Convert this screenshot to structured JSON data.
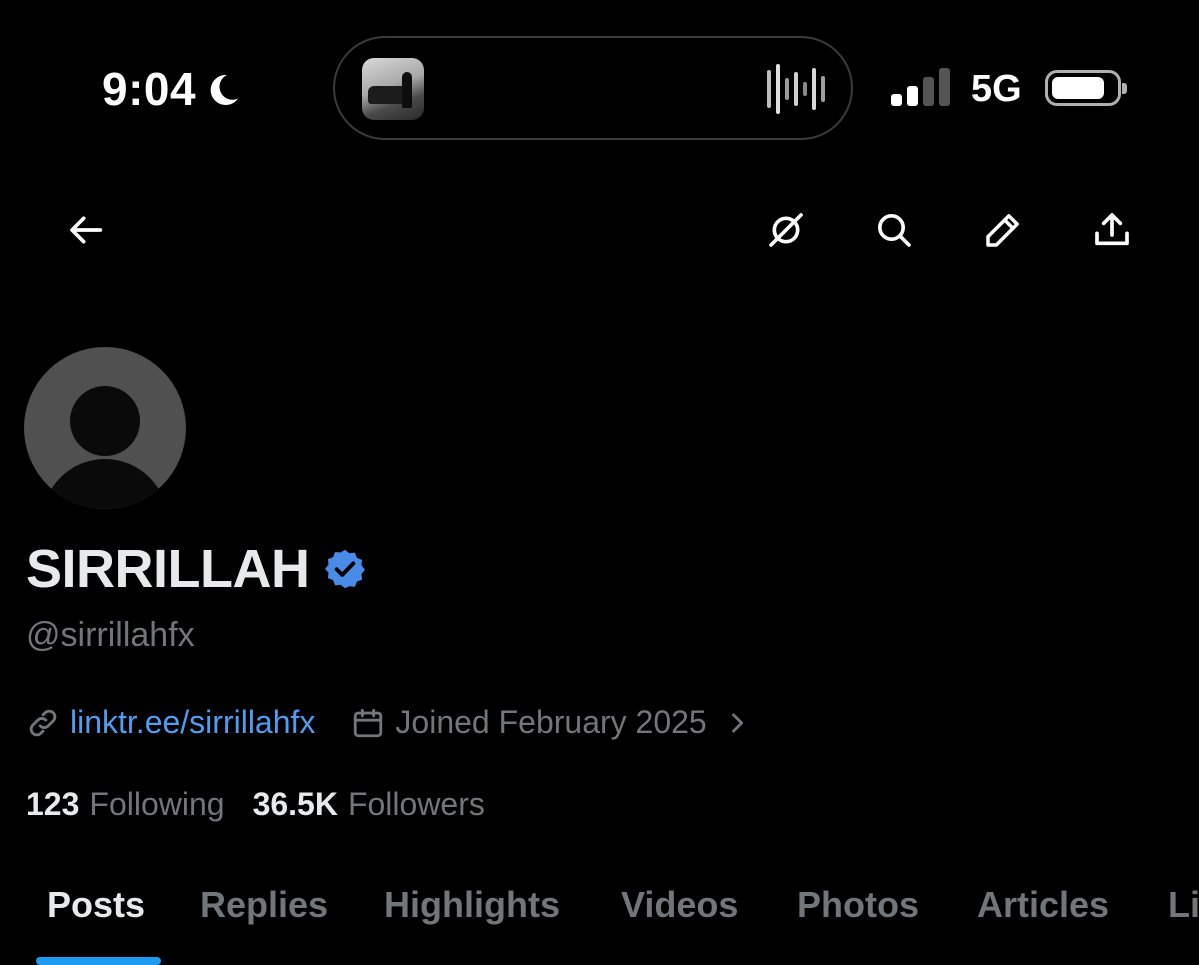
{
  "status_bar": {
    "time": "9:04",
    "network": "5G",
    "focus_icon": "moon-icon",
    "battery_level": 0.8
  },
  "nav": {
    "icons": [
      "back-arrow-icon",
      "grok-icon",
      "search-icon",
      "edit-pencil-icon",
      "share-icon"
    ]
  },
  "profile": {
    "display_name": "SIRRILLAH",
    "verified": true,
    "handle": "@sirrillahfx",
    "link": "linktr.ee/sirrillahfx",
    "joined": "Joined February 2025",
    "following_count": "123",
    "following_label": "Following",
    "followers_count": "36.5K",
    "followers_label": "Followers"
  },
  "tabs": [
    {
      "label": "Posts",
      "active": true
    },
    {
      "label": "Replies"
    },
    {
      "label": "Highlights"
    },
    {
      "label": "Videos"
    },
    {
      "label": "Photos"
    },
    {
      "label": "Articles"
    },
    {
      "label": "Li"
    }
  ],
  "colors": {
    "accent": "#1d9bf0",
    "link": "#4e9df1",
    "muted": "#71767b",
    "verified_badge": "#4a8be8"
  }
}
